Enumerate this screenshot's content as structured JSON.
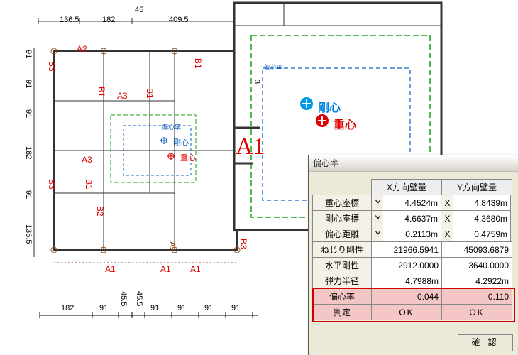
{
  "dimensions_top": [
    "136.5",
    "182",
    "409.5",
    "45"
  ],
  "dimensions_left_top_to_bottom": [
    "91",
    "91",
    "91",
    "182",
    "91",
    "136.5"
  ],
  "dimensions_bottom": [
    "182",
    "91",
    "45.5",
    "45.5",
    "91",
    "91",
    "91",
    "91"
  ],
  "plan_labels": {
    "A1": "A1",
    "A2": "A2",
    "A3": "A3",
    "B1": "B1",
    "B2": "B2",
    "B3": "B3",
    "vert_B3": "B3"
  },
  "center_labels": {
    "gou_small": "剛心",
    "ju_small": "重心",
    "gou_big": "剛心",
    "ju_big": "重心",
    "henshin": "偏心率"
  },
  "bigA1": "A1",
  "right_plan_small": "3",
  "modal": {
    "title": "偏心率",
    "col_x": "X方向壁量",
    "col_y": "Y方向壁量",
    "rows": [
      {
        "label": "重心座標",
        "xL": "Y",
        "x": "4.4524m",
        "yL": "X",
        "y": "4.8439m"
      },
      {
        "label": "剛心座標",
        "xL": "Y",
        "x": "4.6637m",
        "yL": "X",
        "y": "4.3680m"
      },
      {
        "label": "偏心距離",
        "xL": "Y",
        "x": "0.2113m",
        "yL": "X",
        "y": "0.4759m"
      },
      {
        "label": "ねじり剛性",
        "x": "21966.5941",
        "y": "45093.6879"
      },
      {
        "label": "水平剛性",
        "x": "2912.0000",
        "y": "3640.0000"
      },
      {
        "label": "弾力半径",
        "x": "4.7988m",
        "y": "4.2922m"
      },
      {
        "label": "偏心率",
        "x": "0.044",
        "y": "0.110",
        "hl": true
      },
      {
        "label": "判定",
        "x": "OK",
        "y": "OK",
        "hl": true,
        "center": true
      }
    ],
    "ok_button": "確 認"
  },
  "chart_data": {
    "type": "table",
    "title": "偏心率",
    "columns": [
      "",
      "X方向壁量",
      "Y方向壁量"
    ],
    "rows": [
      [
        "重心座標",
        "Y 4.4524m",
        "X 4.8439m"
      ],
      [
        "剛心座標",
        "Y 4.6637m",
        "X 4.3680m"
      ],
      [
        "偏心距離",
        "Y 0.2113m",
        "X 0.4759m"
      ],
      [
        "ねじり剛性",
        "21966.5941",
        "45093.6879"
      ],
      [
        "水平剛性",
        "2912.0000",
        "3640.0000"
      ],
      [
        "弾力半径",
        "4.7988m",
        "4.2922m"
      ],
      [
        "偏心率",
        "0.044",
        "0.110"
      ],
      [
        "判定",
        "OK",
        "OK"
      ]
    ]
  }
}
